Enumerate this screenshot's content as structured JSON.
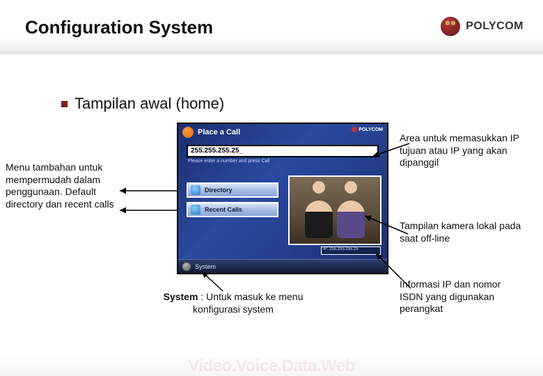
{
  "header": {
    "title": "Configuration System",
    "brand": "POLYCOM"
  },
  "bullet": {
    "text": "Tampilan awal (home)"
  },
  "annotations": {
    "left": "Menu tambahan untuk mempermudah dalam penggunaan. Default directory dan recent calls",
    "top_right": "Area untuk memasukkan IP tujuan atau IP yang akan dipanggil",
    "right_mid": "Tampilan kamera lokal pada saat off-line",
    "right_low": "Informasi IP dan nomor ISDN yang digunakan perangkat",
    "bottom_label": "System",
    "bottom_rest": " : Untuk masuk ke menu konfigurasi system"
  },
  "device": {
    "header_label": "Place a Call",
    "brand_mini": "POLYCOM",
    "ip_value": "255.255.255.25_",
    "ip_caption": "Please enter a number and press Call",
    "menu_directory": "Directory",
    "menu_recent": "Recent Calls",
    "ip_info": "IP: 255.255.255.25",
    "system_label": "System"
  },
  "footer": {
    "watermark": "Video.Voice.Data.Web"
  }
}
